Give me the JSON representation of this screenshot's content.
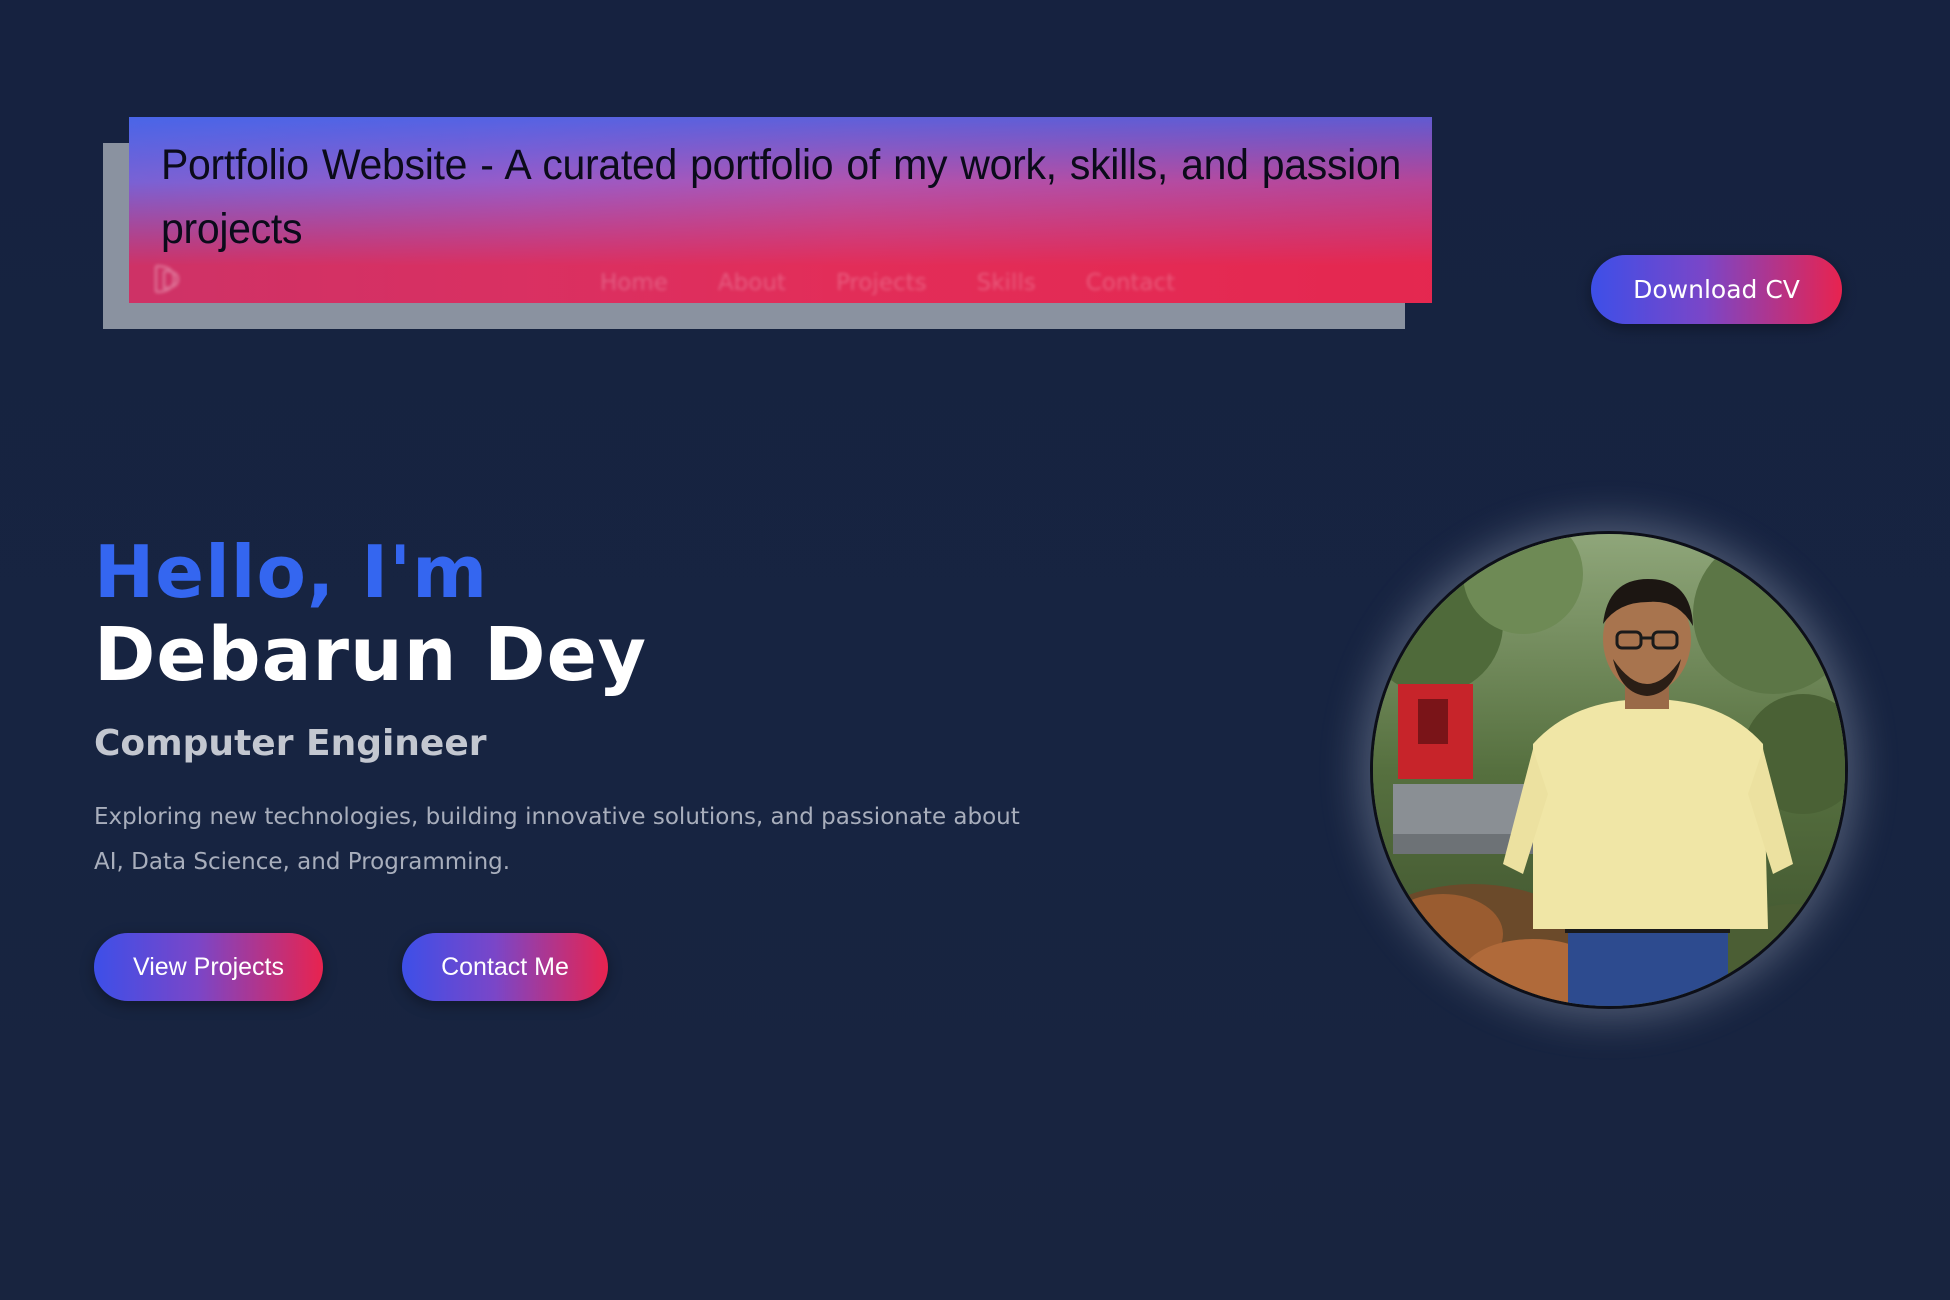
{
  "banner": {
    "title": "Portfolio Website - A curated portfolio of my work, skills, and passion projects"
  },
  "nav": {
    "items": [
      "Home",
      "About",
      "Projects",
      "Skills",
      "Contact"
    ]
  },
  "header": {
    "download_cv_label": "Download CV"
  },
  "hero": {
    "greeting": "Hello, I'm",
    "name": "Debarun Dey",
    "role": "Computer Engineer",
    "description": "Exploring new technologies, building innovative solutions, and passionate about AI, Data Science, and Programming.",
    "view_projects_label": "View Projects",
    "contact_label": "Contact Me"
  },
  "colors": {
    "background": "#172441",
    "accent_blue": "#3466f0",
    "gradient_start": "#3d4fe8",
    "gradient_end": "#e8234f"
  }
}
